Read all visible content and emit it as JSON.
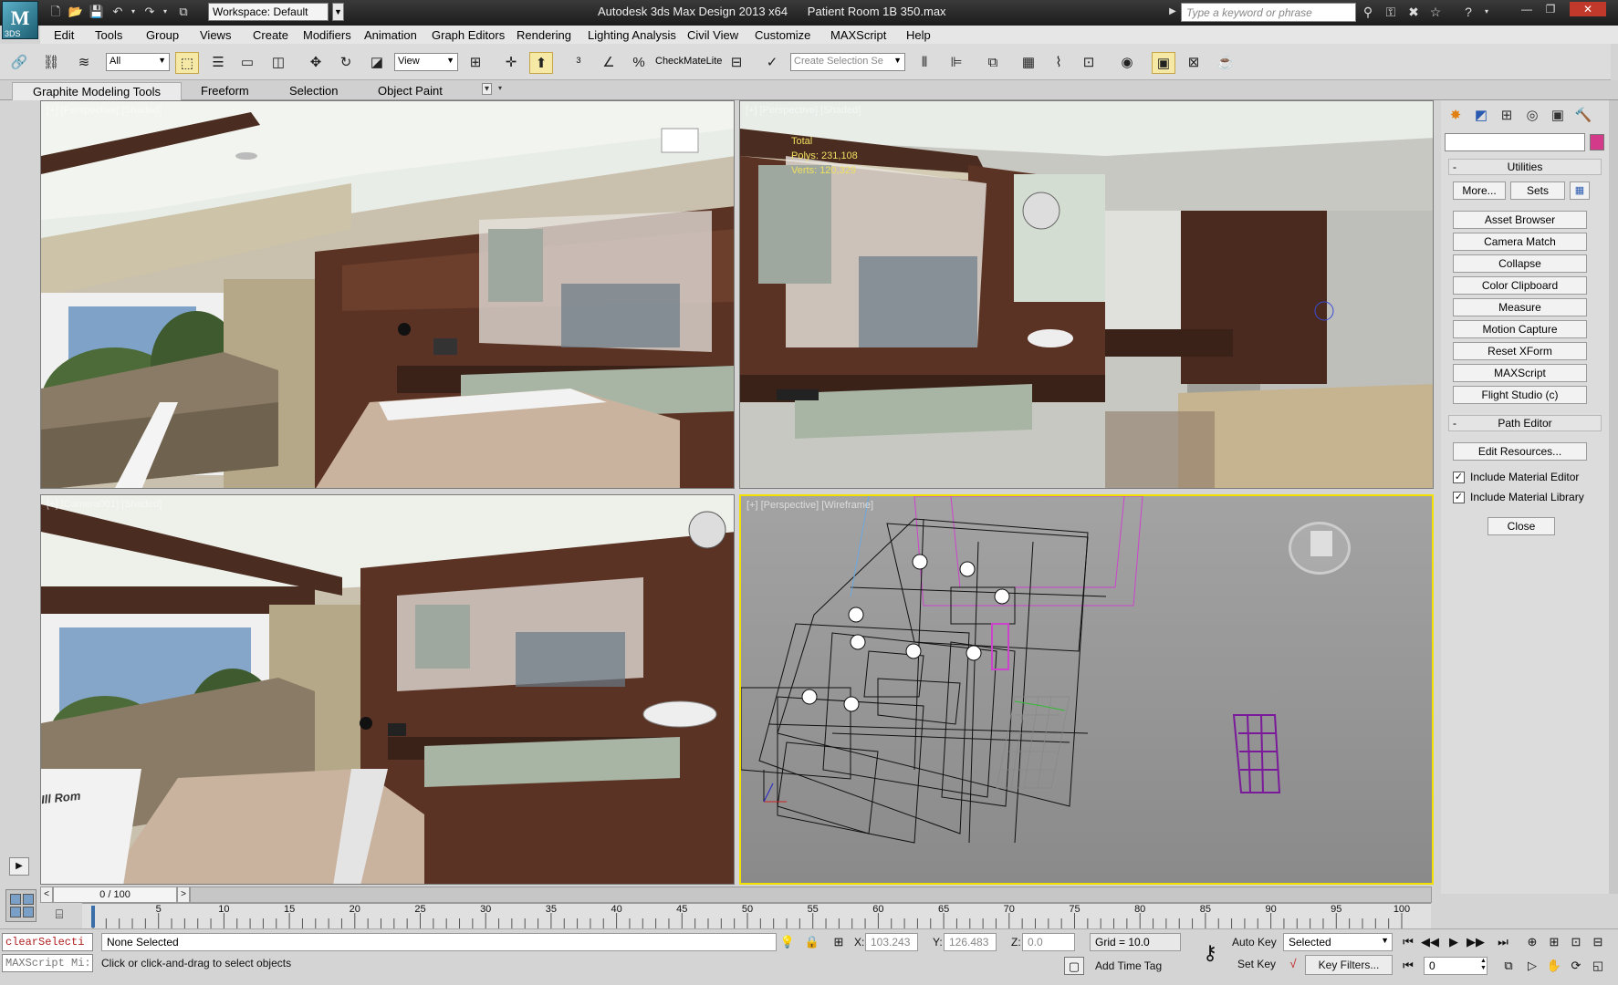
{
  "title_bar": {
    "logo": "M",
    "logo_sub": "3DS",
    "workspace": "Workspace: Default",
    "app_title": "Autodesk 3ds Max Design 2013 x64      Patient Room 1B 350.max",
    "search_placeholder": "Type a keyword or phrase"
  },
  "menu": [
    "Edit",
    "Tools",
    "Group",
    "Views",
    "Create",
    "Modifiers",
    "Animation",
    "Graph Editors",
    "Rendering",
    "Lighting Analysis",
    "Civil View",
    "Customize",
    "MAXScript",
    "Help"
  ],
  "toolbar": {
    "filter": "All",
    "ref_coord": "View",
    "checkmate": "CheckMateLite",
    "selection_set_placeholder": "Create Selection Se"
  },
  "ribbon": {
    "tabs": [
      "Graphite Modeling Tools",
      "Freeform",
      "Selection",
      "Object Paint"
    ]
  },
  "viewports": {
    "tl": {
      "label": "[+] [Perspective] [Shaded]"
    },
    "tr": {
      "label": "[+] [Perspective] [Shaded]",
      "stats_title": "Total",
      "polys_label": "Polys:",
      "polys_value": "231,108",
      "verts_label": "Verts:",
      "verts_value": "120,329"
    },
    "bl": {
      "label": "[+] [Camera001] [Shaded]",
      "sign_text": "Ill Rom"
    },
    "br": {
      "label": "[+] [Perspective] [Wireframe]"
    }
  },
  "command_panel": {
    "utilities_title": "Utilities",
    "more_btn": "More...",
    "sets_btn": "Sets",
    "utility_buttons": [
      "Asset Browser",
      "Camera Match",
      "Collapse",
      "Color Clipboard",
      "Measure",
      "Motion Capture",
      "Reset XForm",
      "MAXScript",
      "Flight Studio (c)"
    ],
    "path_editor_title": "Path Editor",
    "edit_resources": "Edit Resources...",
    "include_material_editor": "Include Material Editor",
    "include_material_library": "Include Material Library",
    "close_btn": "Close"
  },
  "timeline": {
    "frame_counter": "0 / 100",
    "ticks": [
      "5",
      "10",
      "15",
      "20",
      "25",
      "30",
      "35",
      "40",
      "45",
      "50",
      "55",
      "60",
      "65",
      "70",
      "75",
      "80",
      "85",
      "90",
      "95",
      "100"
    ]
  },
  "status": {
    "listener_top": "clearSelecti",
    "listener_bottom": "MAXScript Mi:",
    "selection_status": "None Selected",
    "prompt": "Click or click-and-drag to select objects",
    "x_label": "X:",
    "x_value": "103.243",
    "y_label": "Y:",
    "y_value": "126.483",
    "z_label": "Z:",
    "z_value": "0.0",
    "grid": "Grid = 10.0",
    "add_time_tag": "Add Time Tag",
    "auto_key": "Auto Key",
    "key_mode": "Selected",
    "set_key": "Set Key",
    "key_filters": "Key Filters...",
    "frame_value": "0"
  },
  "colors": {
    "active_viewport_border": "#f2e000",
    "wireframe": "#111111",
    "selected_wire": "#cc44cc"
  }
}
